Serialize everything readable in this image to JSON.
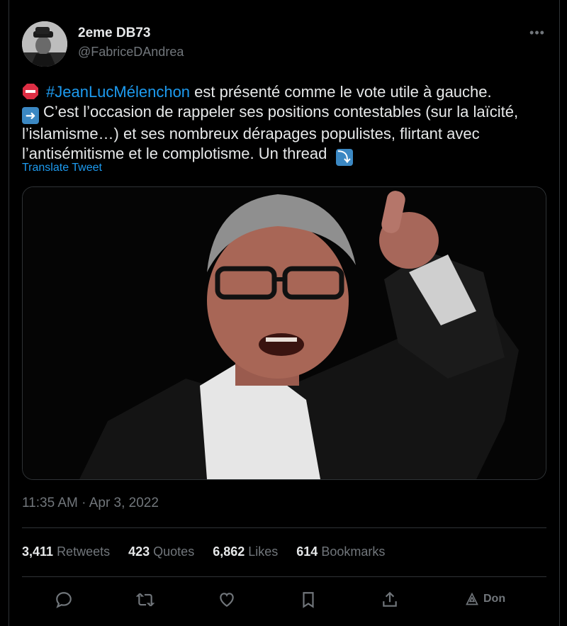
{
  "author": {
    "display_name": "2eme DB73",
    "handle": "@FabriceDAndrea"
  },
  "tweet": {
    "hashtag": "#JeanLucMélenchon",
    "line1_rest": " est présenté comme le vote utile à gauche.",
    "line2": "C’est l’occasion de rappeler ses positions contestables (sur la laïcité, l’islamisme…) et ses nombreux dérapages populistes, flirtant avec l’antisémitisme et le complotisme. Un thread",
    "translate_label": "Translate Tweet",
    "timestamp": "11:35 AM · Apr 3, 2022"
  },
  "stats": [
    {
      "value": "3,411",
      "label": "Retweets"
    },
    {
      "value": "423",
      "label": "Quotes"
    },
    {
      "value": "6,862",
      "label": "Likes"
    },
    {
      "value": "614",
      "label": "Bookmarks"
    }
  ],
  "actions": {
    "reply_icon": "reply-icon",
    "retweet_icon": "retweet-icon",
    "like_icon": "heart-icon",
    "bookmark_icon": "bookmark-icon",
    "share_icon": "share-icon",
    "translate_label": "Don"
  },
  "colors": {
    "background": "#000000",
    "link": "#1d9bf0",
    "muted": "#71767b",
    "border": "#2f3336"
  }
}
